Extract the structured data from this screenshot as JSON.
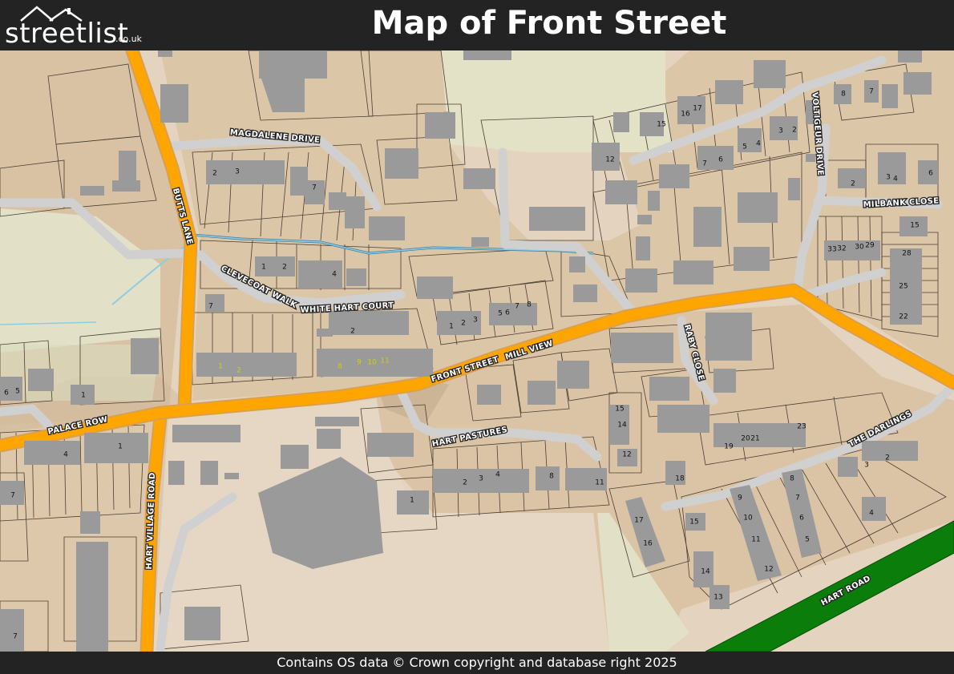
{
  "header": {
    "logo_text": "streetlist",
    "logo_suffix": ".co.uk",
    "title": "Map of Front Street"
  },
  "footer": {
    "copyright": "Contains OS data © Crown copyright and database right 2025"
  },
  "colors": {
    "bar": "#232323",
    "land": "#e4d4bf",
    "parcel": "#d9c2a4",
    "green": "#e2e0c6",
    "main_road": "#ffa500",
    "minor_road": "#d0d0d0",
    "a_road": "#0a7d0a",
    "building": "#9a9a9a",
    "water": "#8ecde0"
  },
  "streets": {
    "front_street": "FRONT STREET",
    "mill_view": "MILL VIEW",
    "butts_lane": "BUTTS LANE",
    "magdalene_drive": "MAGDALENE DRIVE",
    "clevecoat_walk": "CLEVECOAT WALK",
    "white_hart_court": "WHITE HART COURT",
    "palace_row": "PALACE ROW",
    "hart_village_road": "HART VILLAGE ROAD",
    "hart_pastures": "HART PASTURES",
    "raby_close": "RABY CLOSE",
    "volitgeur_drive": "VOLTIGEUR DRIVE",
    "milbank_close": "MILBANK CLOSE",
    "the_darlings": "THE DARLINGS",
    "hart_road": "HART ROAD"
  },
  "house_numbers": [
    "2",
    "3",
    "7",
    "1",
    "2",
    "4",
    "7",
    "2",
    "1",
    "2",
    "8",
    "9",
    "10",
    "11",
    "1",
    "2",
    "3",
    "5",
    "6",
    "7",
    "8",
    "6",
    "5",
    "1",
    "4",
    "1",
    "7",
    "1",
    "2",
    "3",
    "4",
    "8",
    "11",
    "15",
    "14",
    "12",
    "18",
    "19",
    "20",
    "21",
    "23",
    "3",
    "2",
    "4",
    "17",
    "16",
    "15",
    "14",
    "13",
    "9",
    "10",
    "11",
    "12",
    "8",
    "7",
    "6",
    "5",
    "12",
    "15",
    "16",
    "17",
    "7",
    "6",
    "5",
    "4",
    "3",
    "2",
    "8",
    "7",
    "2",
    "3",
    "4",
    "6",
    "15",
    "33",
    "32",
    "30",
    "29",
    "28",
    "25",
    "22",
    "7"
  ]
}
